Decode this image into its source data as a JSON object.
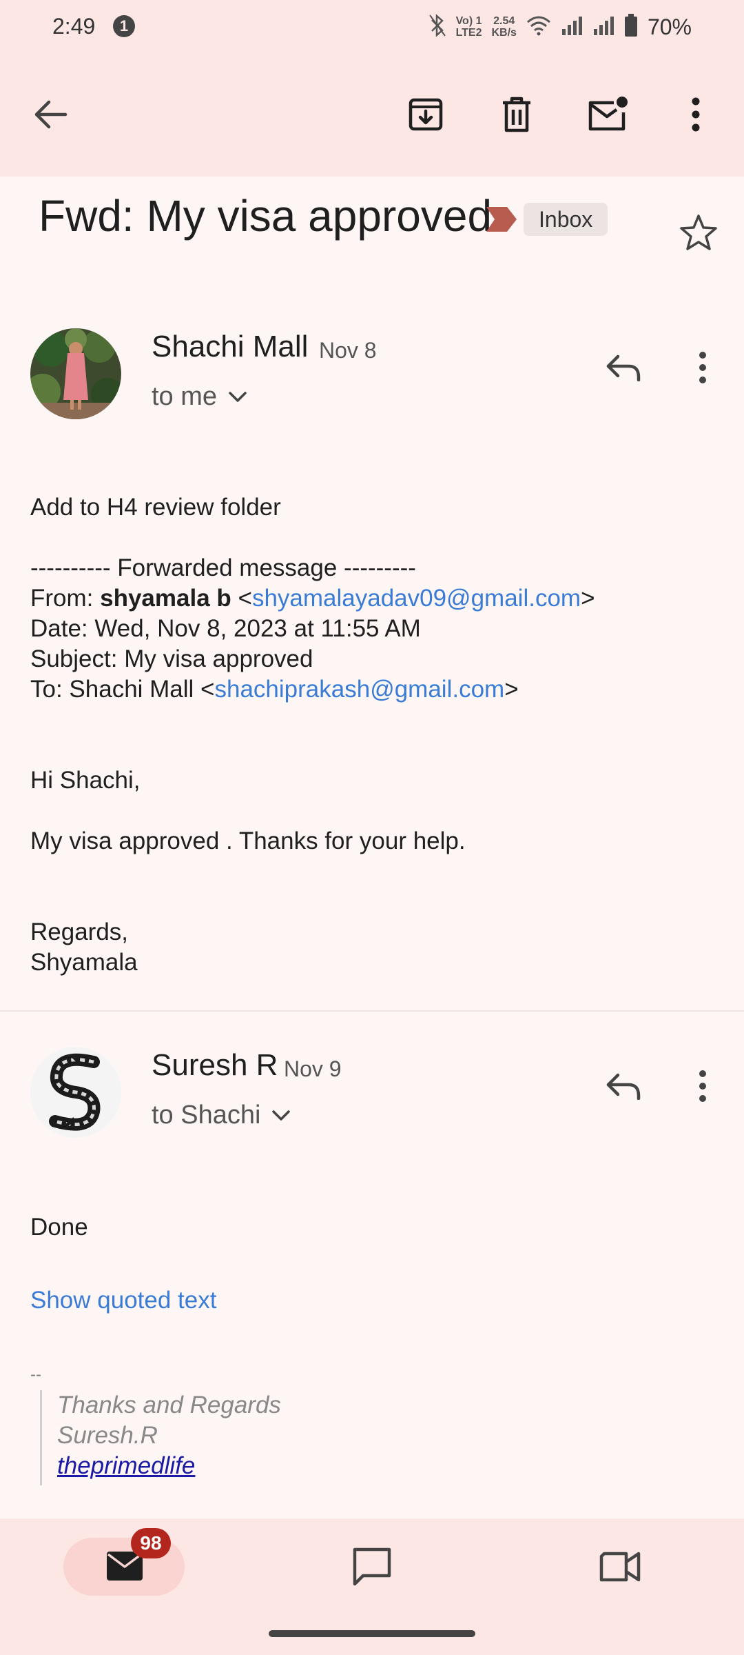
{
  "status_bar": {
    "time": "2:49",
    "notification_count": "1",
    "network_top": "Vo) 1",
    "network_bottom": "LTE2",
    "speed_top": "2.54",
    "speed_bottom": "KB/s",
    "battery": "70%"
  },
  "email": {
    "subject": "Fwd: My visa approved",
    "label": "Inbox",
    "label_color": "#b85c50"
  },
  "message1": {
    "sender": "Shachi Mall",
    "date": "Nov 8",
    "recipient": "to me",
    "body_line1": "Add to H4 review folder",
    "fwd_header": "---------- Forwarded message ---------",
    "from_label": "From: ",
    "from_name": "shyamala b",
    "from_email": "shyamalayadav09@gmail.com",
    "open_bracket": " <",
    "close_bracket": ">",
    "date_line": "Date: Wed, Nov 8, 2023 at 11:55 AM",
    "subject_line": "Subject: My visa approved",
    "to_label": "To: Shachi Mall <",
    "to_email": "shachiprakash@gmail.com",
    "greeting": "Hi Shachi,",
    "message": "My visa approved . Thanks for your help.",
    "regards": "Regards,",
    "signoff": "Shyamala"
  },
  "message2": {
    "sender": "Suresh R",
    "date": "Nov 9",
    "recipient": "to Shachi",
    "body": "Done",
    "show_quoted": "Show quoted text",
    "sig_dash": "--",
    "sig_line1": "Thanks and Regards",
    "sig_line2": "Suresh.R",
    "sig_link": "theprimedlife"
  },
  "bottom_nav": {
    "mail_badge": "98"
  }
}
